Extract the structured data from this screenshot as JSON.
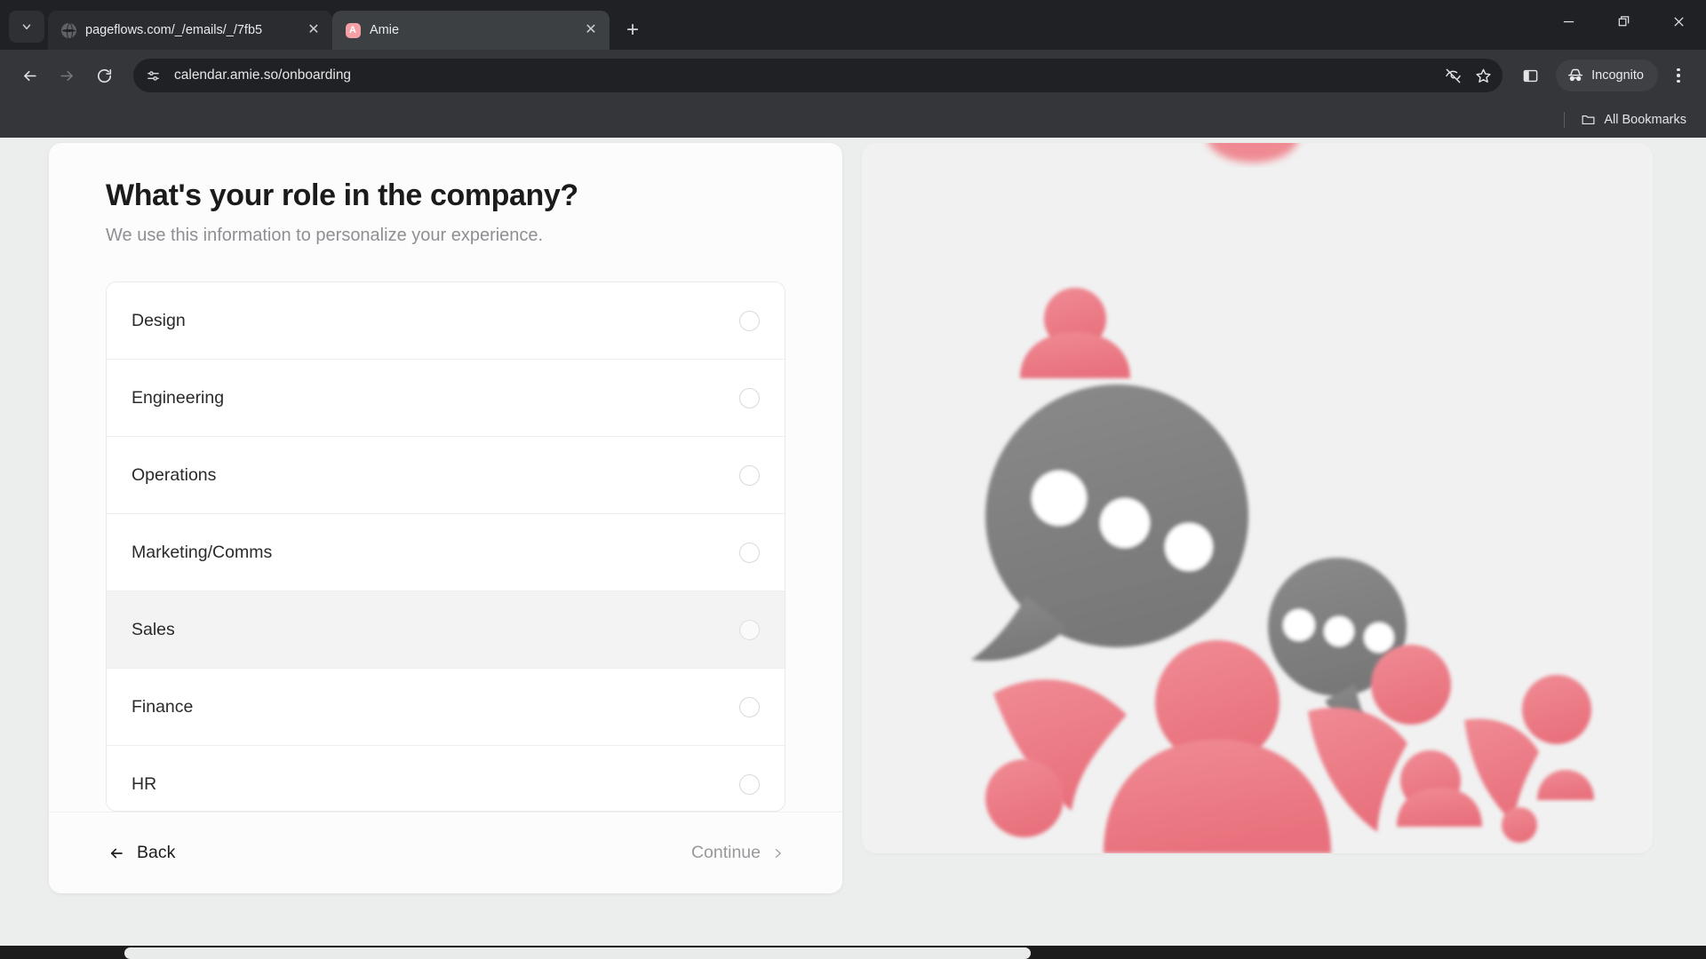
{
  "browser": {
    "tabs": [
      {
        "title": "pageflows.com/_/emails/_/7fb5",
        "favicon": "globe-icon",
        "active": false,
        "close_label": "✕"
      },
      {
        "title": "Amie",
        "favicon": "amie-logo-icon",
        "favicon_letter": "A",
        "active": true,
        "close_label": "✕"
      }
    ],
    "new_tab_label": "+",
    "omnibox": {
      "url": "calendar.amie.so/onboarding",
      "site_icon": "site-settings-icon",
      "tracking_icon": "eye-off-icon",
      "bookmark_icon": "star-icon"
    },
    "toolbar": {
      "back_icon": "arrow-left-icon",
      "forward_icon": "arrow-right-icon",
      "reload_icon": "reload-icon",
      "split_icon": "side-panel-icon",
      "menu_icon": "kebab-menu-icon"
    },
    "profile": {
      "label": "Incognito",
      "icon": "incognito-icon"
    },
    "window_controls": {
      "minimize": "minimize-icon",
      "maximize": "restore-icon",
      "close": "close-icon"
    },
    "bookmarks_bar": {
      "all_bookmarks_label": "All Bookmarks",
      "folder_icon": "folder-icon"
    }
  },
  "colors": {
    "chrome_bg": "#202124",
    "toolbar_bg": "#35363a",
    "page_bg": "#eceded",
    "card_bg": "#fcfcfc",
    "accent_pink": "#ec7b85",
    "bubble_gray": "#808080",
    "panel_bg": "#f1f1f1"
  },
  "page": {
    "title": "What's your role in the company?",
    "subtitle": "We use this information to personalize your experience.",
    "options": [
      {
        "label": "Design",
        "selected": false,
        "hovered": false
      },
      {
        "label": "Engineering",
        "selected": false,
        "hovered": false
      },
      {
        "label": "Operations",
        "selected": false,
        "hovered": false
      },
      {
        "label": "Marketing/Comms",
        "selected": false,
        "hovered": false
      },
      {
        "label": "Sales",
        "selected": false,
        "hovered": true
      },
      {
        "label": "Finance",
        "selected": false,
        "hovered": false
      },
      {
        "label": "HR",
        "selected": false,
        "hovered": false
      }
    ],
    "footer": {
      "back_label": "Back",
      "back_icon": "arrow-left-icon",
      "continue_label": "Continue",
      "continue_icon": "chevron-right-icon"
    },
    "illustration": {
      "name": "people-chat-bubbles-illustration",
      "description": "Pink person silhouettes with gray speech bubbles containing white dots"
    }
  }
}
